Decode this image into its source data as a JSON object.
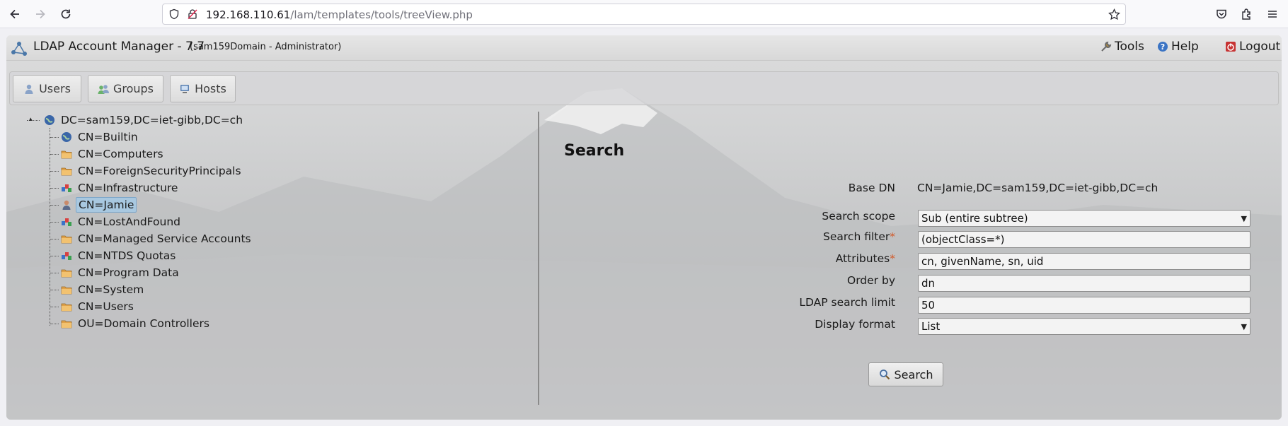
{
  "browser": {
    "url_host": "192.168.110.61",
    "url_path": "/lam/templates/tools/treeView.php"
  },
  "app": {
    "title": "LDAP Account Manager - 7.7",
    "subtitle": "(sam159Domain - Administrator)",
    "tools_label": "Tools",
    "help_label": "Help",
    "logout_label": "Logout"
  },
  "tabs": [
    {
      "label": "Users",
      "icon": "user-icon"
    },
    {
      "label": "Groups",
      "icon": "groups-icon"
    },
    {
      "label": "Hosts",
      "icon": "host-icon"
    }
  ],
  "tree": {
    "root": "DC=sam159,DC=iet-gibb,DC=ch",
    "children": [
      {
        "label": "CN=Builtin",
        "icon": "globe-icon"
      },
      {
        "label": "CN=Computers",
        "icon": "folder-icon"
      },
      {
        "label": "CN=ForeignSecurityPrincipals",
        "icon": "folder-icon"
      },
      {
        "label": "CN=Infrastructure",
        "icon": "objects-icon"
      },
      {
        "label": "CN=Jamie",
        "icon": "user-icon",
        "selected": true
      },
      {
        "label": "CN=LostAndFound",
        "icon": "objects-icon"
      },
      {
        "label": "CN=Managed Service Accounts",
        "icon": "folder-icon"
      },
      {
        "label": "CN=NTDS Quotas",
        "icon": "objects-icon"
      },
      {
        "label": "CN=Program Data",
        "icon": "folder-icon"
      },
      {
        "label": "CN=System",
        "icon": "folder-icon"
      },
      {
        "label": "CN=Users",
        "icon": "folder-icon"
      },
      {
        "label": "OU=Domain Controllers",
        "icon": "folder-icon"
      }
    ]
  },
  "search": {
    "title": "Search",
    "base_dn_label": "Base DN",
    "base_dn_value": "CN=Jamie,DC=sam159,DC=iet-gibb,DC=ch",
    "scope_label": "Search scope",
    "scope_value": "Sub (entire subtree)",
    "filter_label": "Search filter",
    "filter_value": "(objectClass=*)",
    "attributes_label": "Attributes",
    "attributes_value": "cn, givenName, sn, uid",
    "orderby_label": "Order by",
    "orderby_value": "dn",
    "limit_label": "LDAP search limit",
    "limit_value": "50",
    "format_label": "Display format",
    "format_value": "List",
    "required_mark": "*",
    "button_label": "Search"
  }
}
